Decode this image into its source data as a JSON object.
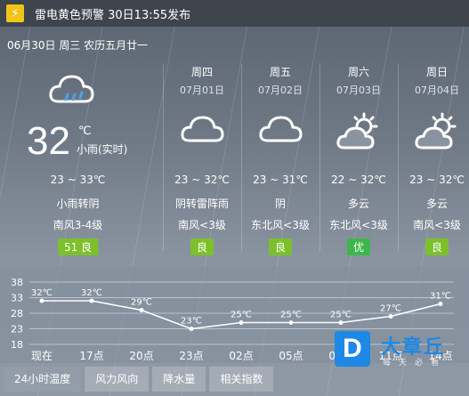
{
  "alert": {
    "text": "雷电黄色预警 30日13:55发布",
    "icon": "lightning-icon",
    "color": "#f2c418"
  },
  "date_line": "06月30日 周三 农历五月廿一",
  "today": {
    "icon": "cloud-rain-icon",
    "temp": "32",
    "unit": "℃",
    "desc": "小雨(实时)",
    "range": "23 ~ 33℃",
    "condition": "小雨转阴",
    "wind": "南风3-4级",
    "aqi": "51 良",
    "aqi_color": "#7cc12b"
  },
  "days": [
    {
      "name": "周四",
      "date": "07月01日",
      "icon": "cloud-icon",
      "range": "23 ~ 32℃",
      "condition": "阴转雷阵雨",
      "wind": "南风<3级",
      "aqi": "良",
      "aqi_color": "#7cc12b"
    },
    {
      "name": "周五",
      "date": "07月02日",
      "icon": "cloud-icon",
      "range": "23 ~ 31℃",
      "condition": "阴",
      "wind": "东北风<3级",
      "aqi": "良",
      "aqi_color": "#7cc12b"
    },
    {
      "name": "周六",
      "date": "07月03日",
      "icon": "partly-cloudy-icon",
      "range": "22 ~ 32℃",
      "condition": "多云",
      "wind": "东北风<3级",
      "aqi": "优",
      "aqi_color": "#3cb84b"
    },
    {
      "name": "周日",
      "date": "07月04日",
      "icon": "partly-cloudy-icon",
      "range": "23 ~ 32℃",
      "condition": "多云",
      "wind": "南风<3级",
      "aqi": "良",
      "aqi_color": "#7cc12b"
    }
  ],
  "chart_data": {
    "type": "line",
    "categories": [
      "现在",
      "17点",
      "20点",
      "23点",
      "02点",
      "05点",
      "08点",
      "11点",
      "14点"
    ],
    "values": [
      32,
      32,
      29,
      23,
      25,
      25,
      25,
      27,
      31
    ],
    "value_labels": [
      "32℃",
      "32℃",
      "29℃",
      "23℃",
      "25℃",
      "25℃",
      "25℃",
      "27℃",
      "31℃"
    ],
    "yticks": [
      38,
      33,
      28,
      23,
      18
    ],
    "ylim": [
      18,
      38
    ],
    "grid": true
  },
  "tabs": [
    "24小时温度",
    "风力风向",
    "降水量",
    "相关指数"
  ],
  "watermark": {
    "brand": "大章丘",
    "sub": "每天必看",
    "letter": "D"
  }
}
